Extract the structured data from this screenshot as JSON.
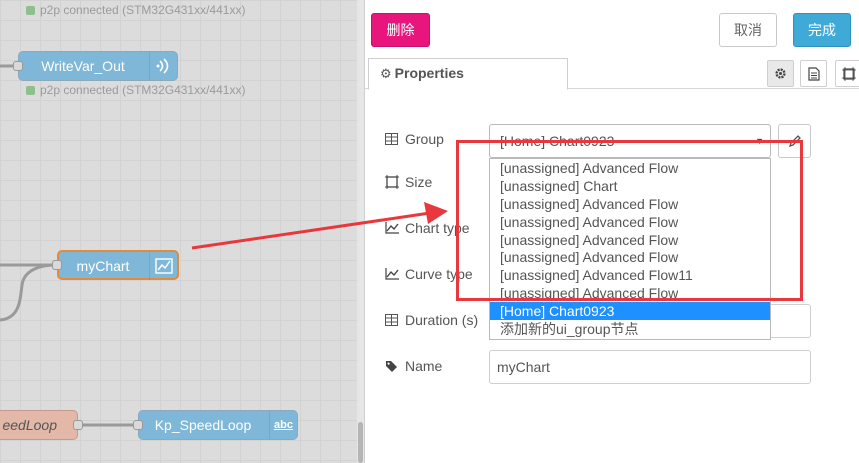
{
  "canvas": {
    "nodes": {
      "writevar": {
        "label": "WriteVar_Out",
        "icon": "wireless-icon",
        "status": "p2p connected (STM32G431xx/441xx)"
      },
      "top_status": "p2p connected (STM32G431xx/441xx)",
      "mychart": {
        "label": "myChart",
        "icon": "chart-icon"
      },
      "speedloop": {
        "label": "eedLoop"
      },
      "kp": {
        "label": "Kp_SpeedLoop",
        "icon_text": "abc"
      }
    }
  },
  "panel": {
    "buttons": {
      "delete": "删除",
      "cancel": "取消",
      "done": "完成"
    },
    "tabs": {
      "properties": "Properties"
    },
    "fields": {
      "group": "Group",
      "size": "Size",
      "chart_type": "Chart type",
      "curve_type": "Curve type",
      "duration": "Duration (s)",
      "name": "Name"
    },
    "group_value": "[Home] Chart0923",
    "group_options": [
      "[unassigned] Advanced Flow",
      "[unassigned] Chart",
      "[unassigned] Advanced Flow",
      "[unassigned] Advanced Flow",
      "[unassigned] Advanced Flow",
      "[unassigned] Advanced Flow",
      "[unassigned] Advanced Flow11",
      "[unassigned] Advanced Flow",
      "[Home] Chart0923",
      "添加新的ui_group节点"
    ],
    "selected_option_index": 8,
    "name_value": "myChart"
  },
  "annotation_color": "#e8383d"
}
